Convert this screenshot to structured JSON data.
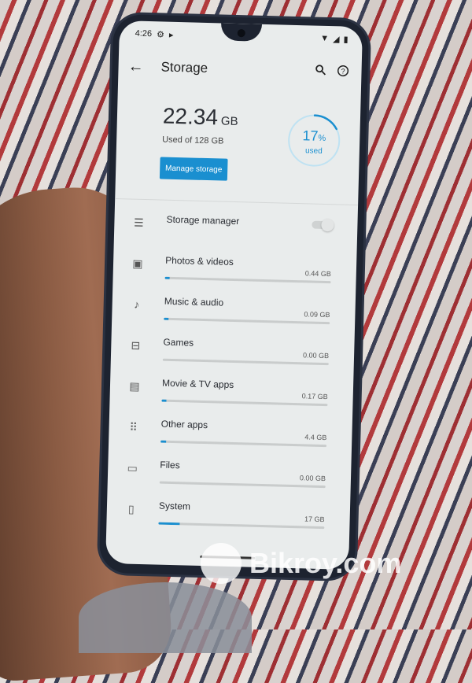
{
  "status_bar": {
    "time": "4:26",
    "left_icons": [
      "settings-icon",
      "cast-icon"
    ],
    "right_icons": [
      "wifi-icon",
      "signal-icon",
      "battery-icon"
    ]
  },
  "app_bar": {
    "title": "Storage",
    "icons": [
      "back-arrow-icon",
      "search-icon",
      "help-icon"
    ]
  },
  "summary": {
    "used_value": "22.34",
    "used_unit": "GB",
    "used_of": "Used of 128 GB",
    "manage_button": "Manage storage",
    "percent_value": "17",
    "percent_sign": "%",
    "percent_label": "used",
    "percent_fraction": 0.17,
    "accent_color": "#1a8fd0"
  },
  "list": [
    {
      "label": "Storage manager",
      "icon": "storage-manager-icon",
      "toggle": false
    },
    {
      "label": "Photos & videos",
      "size": "0.44 GB",
      "icon": "photos-icon",
      "fraction": 0.003
    },
    {
      "label": "Music & audio",
      "size": "0.09 GB",
      "icon": "music-note-icon",
      "fraction": 0.001
    },
    {
      "label": "Games",
      "size": "0.00 GB",
      "icon": "gamepad-icon",
      "fraction": 0
    },
    {
      "label": "Movie & TV apps",
      "size": "0.17 GB",
      "icon": "movie-icon",
      "fraction": 0.001
    },
    {
      "label": "Other apps",
      "size": "4.4 GB",
      "icon": "apps-grid-icon",
      "fraction": 0.034
    },
    {
      "label": "Files",
      "size": "0.00 GB",
      "icon": "folder-icon",
      "fraction": 0
    },
    {
      "label": "System",
      "size": "17 GB",
      "icon": "system-icon",
      "fraction": 0.13
    }
  ],
  "watermark": "Bikroy.com"
}
